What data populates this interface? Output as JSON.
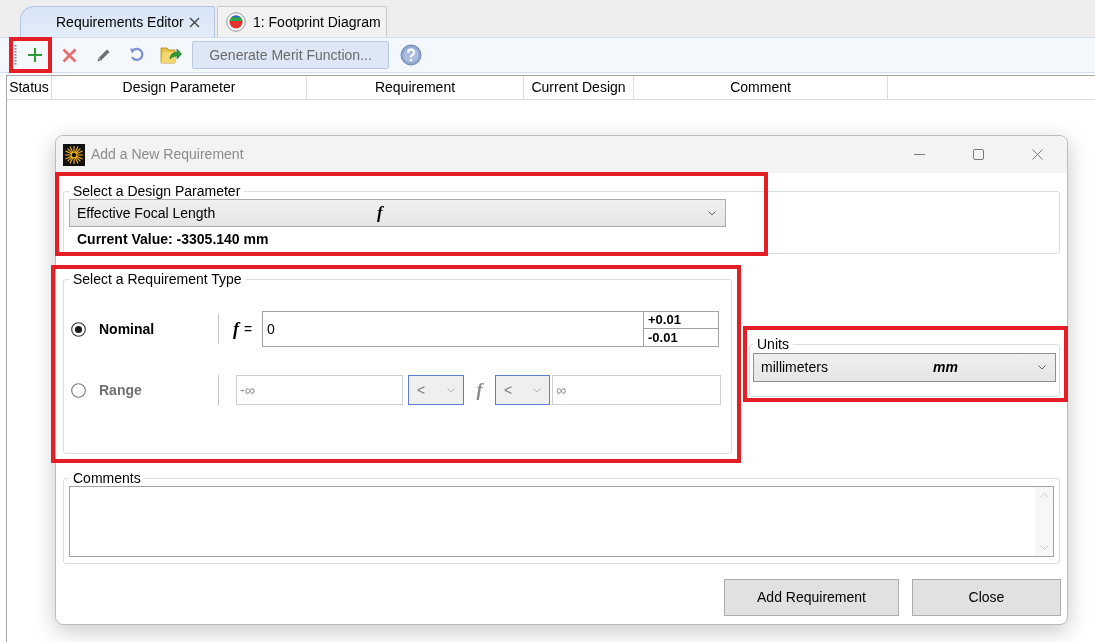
{
  "tabs": [
    {
      "label": "Requirements Editor",
      "kind": "editor",
      "selected": true
    },
    {
      "label": "1: Footprint Diagram",
      "kind": "analysis",
      "selected": false
    }
  ],
  "toolbar": {
    "tools": [
      {
        "kind": "add",
        "highlighted": true
      },
      {
        "kind": "delete",
        "highlighted": false
      },
      {
        "kind": "edit",
        "highlighted": false
      },
      {
        "kind": "undo",
        "highlighted": false
      },
      {
        "kind": "import",
        "highlighted": false
      }
    ],
    "generate_button": {
      "label": "Generate Merit Function...",
      "disabled": true
    }
  },
  "table": {
    "columns": [
      "Status",
      "Design Parameter",
      "Requirement",
      "Current Design",
      "Comment"
    ]
  },
  "dialog": {
    "title": "Add a New Requirement",
    "design_parameter": {
      "legend": "Select a Design Parameter",
      "highlighted": true,
      "value": "Effective Focal Length",
      "symbol": "f",
      "current_value": "Current Value: -3305.140 mm"
    },
    "requirement_type": {
      "legend": "Select a Requirement Type",
      "highlighted": true,
      "options": [
        {
          "kind": "nominal",
          "label": "Nominal",
          "selected": true,
          "symbol": "f",
          "relation": "=",
          "value": "0",
          "plus_tolerance": "+0.01",
          "minus_tolerance": "-0.01"
        },
        {
          "kind": "range",
          "label": "Range",
          "selected": false,
          "lower_value": "-∞",
          "lower_operator": "<",
          "symbol": "f",
          "upper_operator": "<",
          "upper_value": "∞"
        }
      ]
    },
    "units": {
      "legend": "Units",
      "highlighted": true,
      "value": "millimeters",
      "symbol": "mm"
    },
    "comments": {
      "legend": "Comments"
    },
    "buttons": [
      "Add Requirement",
      "Close"
    ]
  }
}
